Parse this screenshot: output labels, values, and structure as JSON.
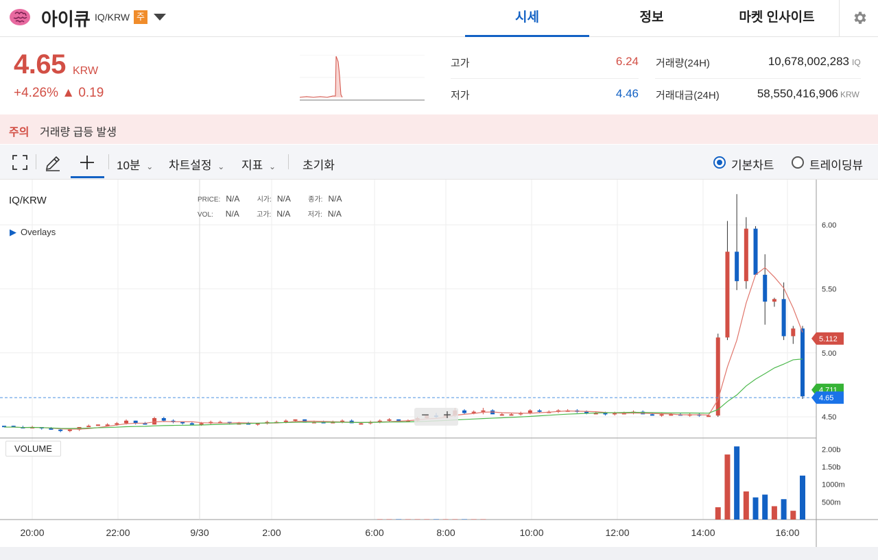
{
  "header": {
    "coin_name": "아이큐",
    "pair": "IQ/KRW",
    "warn_badge": "주",
    "tabs": [
      {
        "label": "시세",
        "active": true
      },
      {
        "label": "정보",
        "active": false
      },
      {
        "label": "마켓 인사이트",
        "active": false
      }
    ]
  },
  "summary": {
    "price": "4.65",
    "unit": "KRW",
    "change": "+4.26% ▲ 0.19",
    "high_label": "고가",
    "high_value": "6.24",
    "low_label": "저가",
    "low_value": "4.46",
    "volume_label": "거래량(24H)",
    "volume_value": "10,678,002,283",
    "volume_unit": "IQ",
    "amount_label": "거래대금(24H)",
    "amount_value": "58,550,416,906",
    "amount_unit": "KRW",
    "colors": {
      "up": "#d24f45",
      "down": "#1261c4"
    }
  },
  "notice": {
    "label": "주의",
    "text": "거래량 급등 발생"
  },
  "toolbar": {
    "interval": "10분",
    "chart_settings": "차트설정",
    "indicators": "지표",
    "reset": "초기화",
    "basic_chart": "기본차트",
    "tradingview": "트레이딩뷰"
  },
  "chart": {
    "pair_label": "IQ/KRW",
    "ohlc_row1": [
      [
        "PRICE:",
        "N/A"
      ],
      [
        "시가:",
        "N/A"
      ],
      [
        "종가:",
        "N/A"
      ]
    ],
    "ohlc_row2": [
      [
        "VOL:",
        "N/A"
      ],
      [
        "고가:",
        "N/A"
      ],
      [
        "저가:",
        "N/A"
      ]
    ],
    "overlays": "Overlays",
    "volume_label": "VOLUME",
    "zoom_minus": "−",
    "zoom_plus": "+"
  },
  "chart_data": {
    "type": "candlestick",
    "price_axis": [
      "6.00",
      "5.50",
      "5.00",
      "4.50"
    ],
    "volume_axis": [
      "2.00b",
      "1.50b",
      "1000m",
      "500m"
    ],
    "time_axis": [
      "20:00",
      "22:00",
      "9/30",
      "2:00",
      "6:00",
      "8:00",
      "10:00",
      "12:00",
      "14:00",
      "16:00"
    ],
    "ylim": [
      4.43,
      6.24
    ],
    "current_price": 4.65,
    "ma_value": 4.711,
    "ma_long_value": 5.112,
    "candles": [
      [
        4.43,
        4.43,
        4.43,
        4.42,
        0
      ],
      [
        4.43,
        4.43,
        4.42,
        4.42,
        0
      ],
      [
        4.42,
        4.43,
        4.41,
        4.41,
        0
      ],
      [
        4.42,
        4.43,
        4.41,
        4.42,
        0
      ],
      [
        4.42,
        4.42,
        4.4,
        4.41,
        0
      ],
      [
        4.41,
        4.42,
        4.4,
        4.4,
        0
      ],
      [
        4.4,
        4.41,
        4.38,
        4.39,
        0
      ],
      [
        4.39,
        4.41,
        4.38,
        4.4,
        0
      ],
      [
        4.4,
        4.42,
        4.39,
        4.42,
        0
      ],
      [
        4.42,
        4.44,
        4.42,
        4.43,
        0
      ],
      [
        4.43,
        4.44,
        4.43,
        4.44,
        0
      ],
      [
        4.44,
        4.45,
        4.43,
        4.44,
        0
      ],
      [
        4.44,
        4.46,
        4.43,
        4.45,
        0
      ],
      [
        4.45,
        4.48,
        4.44,
        4.47,
        0
      ],
      [
        4.47,
        4.47,
        4.44,
        4.45,
        0
      ],
      [
        4.45,
        4.46,
        4.44,
        4.44,
        0
      ],
      [
        4.44,
        4.5,
        4.44,
        4.49,
        0
      ],
      [
        4.49,
        4.5,
        4.46,
        4.47,
        0
      ],
      [
        4.47,
        4.48,
        4.45,
        4.46,
        0
      ],
      [
        4.46,
        4.46,
        4.44,
        4.45,
        0
      ],
      [
        4.45,
        4.46,
        4.44,
        4.44,
        0
      ],
      [
        4.44,
        4.46,
        4.43,
        4.45,
        0
      ],
      [
        4.45,
        4.47,
        4.44,
        4.46,
        0
      ],
      [
        4.46,
        4.47,
        4.45,
        4.46,
        0
      ],
      [
        4.46,
        4.46,
        4.44,
        4.45,
        0
      ],
      [
        4.45,
        4.46,
        4.44,
        4.45,
        0
      ],
      [
        4.45,
        4.46,
        4.44,
        4.44,
        0
      ],
      [
        4.44,
        4.45,
        4.43,
        4.45,
        0
      ],
      [
        4.45,
        4.47,
        4.44,
        4.46,
        0
      ],
      [
        4.46,
        4.47,
        4.45,
        4.46,
        0
      ],
      [
        4.46,
        4.48,
        4.45,
        4.47,
        0
      ],
      [
        4.47,
        4.48,
        4.46,
        4.48,
        0
      ],
      [
        4.48,
        4.48,
        4.46,
        4.46,
        0
      ],
      [
        4.46,
        4.47,
        4.45,
        4.46,
        0
      ],
      [
        4.46,
        4.47,
        4.45,
        4.45,
        0
      ],
      [
        4.45,
        4.47,
        4.45,
        4.46,
        0
      ],
      [
        4.46,
        4.48,
        4.45,
        4.47,
        0
      ],
      [
        4.47,
        4.48,
        4.45,
        4.45,
        0
      ],
      [
        4.45,
        4.46,
        4.44,
        4.45,
        0
      ],
      [
        4.45,
        4.47,
        4.44,
        4.46,
        0
      ],
      [
        4.46,
        4.48,
        4.45,
        4.47,
        0.01
      ],
      [
        4.47,
        4.49,
        4.46,
        4.48,
        0.01
      ],
      [
        4.48,
        4.48,
        4.46,
        4.47,
        0.01
      ],
      [
        4.47,
        4.48,
        4.46,
        4.47,
        0.01
      ],
      [
        4.47,
        4.5,
        4.46,
        4.49,
        0.01
      ],
      [
        4.49,
        4.52,
        4.48,
        4.51,
        0.01
      ],
      [
        4.51,
        4.53,
        4.49,
        4.5,
        0.01
      ],
      [
        4.5,
        4.52,
        4.49,
        4.51,
        0.01
      ],
      [
        4.51,
        4.57,
        4.5,
        4.55,
        0.01
      ],
      [
        4.55,
        4.56,
        4.52,
        4.53,
        0.01
      ],
      [
        4.53,
        4.55,
        4.52,
        4.54,
        0.01
      ],
      [
        4.54,
        4.57,
        4.52,
        4.55,
        0.01
      ],
      [
        4.55,
        4.56,
        4.52,
        4.52,
        0
      ],
      [
        4.52,
        4.53,
        4.51,
        4.52,
        0
      ],
      [
        4.52,
        4.53,
        4.51,
        4.52,
        0
      ],
      [
        4.52,
        4.54,
        4.51,
        4.53,
        0
      ],
      [
        4.53,
        4.56,
        4.52,
        4.55,
        0
      ],
      [
        4.55,
        4.56,
        4.53,
        4.54,
        0
      ],
      [
        4.54,
        4.55,
        4.53,
        4.54,
        0
      ],
      [
        4.54,
        4.56,
        4.53,
        4.55,
        0
      ],
      [
        4.55,
        4.56,
        4.54,
        4.55,
        0
      ],
      [
        4.55,
        4.56,
        4.53,
        4.54,
        0
      ],
      [
        4.54,
        4.55,
        4.52,
        4.53,
        0
      ],
      [
        4.53,
        4.54,
        4.52,
        4.53,
        0
      ],
      [
        4.53,
        4.54,
        4.51,
        4.52,
        0
      ],
      [
        4.52,
        4.54,
        4.51,
        4.53,
        0
      ],
      [
        4.53,
        4.54,
        4.52,
        4.53,
        0
      ],
      [
        4.53,
        4.55,
        4.52,
        4.54,
        0
      ],
      [
        4.54,
        4.55,
        4.52,
        4.52,
        0
      ],
      [
        4.52,
        4.53,
        4.51,
        4.51,
        0
      ],
      [
        4.51,
        4.53,
        4.5,
        4.52,
        0
      ],
      [
        4.52,
        4.53,
        4.51,
        4.52,
        0
      ],
      [
        4.52,
        4.53,
        4.51,
        4.51,
        0
      ],
      [
        4.51,
        4.53,
        4.5,
        4.52,
        0
      ],
      [
        4.52,
        4.53,
        4.5,
        4.51,
        0
      ],
      [
        4.51,
        4.52,
        4.5,
        4.51,
        0
      ],
      [
        4.51,
        5.15,
        4.5,
        5.12,
        0.35
      ],
      [
        5.12,
        6.03,
        5.1,
        5.79,
        1.85
      ],
      [
        5.79,
        6.24,
        5.49,
        5.56,
        2.08
      ],
      [
        5.56,
        6.06,
        5.5,
        5.97,
        0.8
      ],
      [
        5.97,
        5.99,
        5.62,
        5.61,
        0.63
      ],
      [
        5.61,
        5.77,
        5.22,
        5.4,
        0.71
      ],
      [
        5.4,
        5.43,
        5.36,
        5.42,
        0.38
      ],
      [
        5.42,
        5.55,
        5.1,
        5.13,
        0.58
      ],
      [
        5.13,
        5.21,
        5.07,
        5.19,
        0.25
      ],
      [
        5.19,
        5.21,
        4.64,
        4.66,
        1.25
      ]
    ]
  }
}
